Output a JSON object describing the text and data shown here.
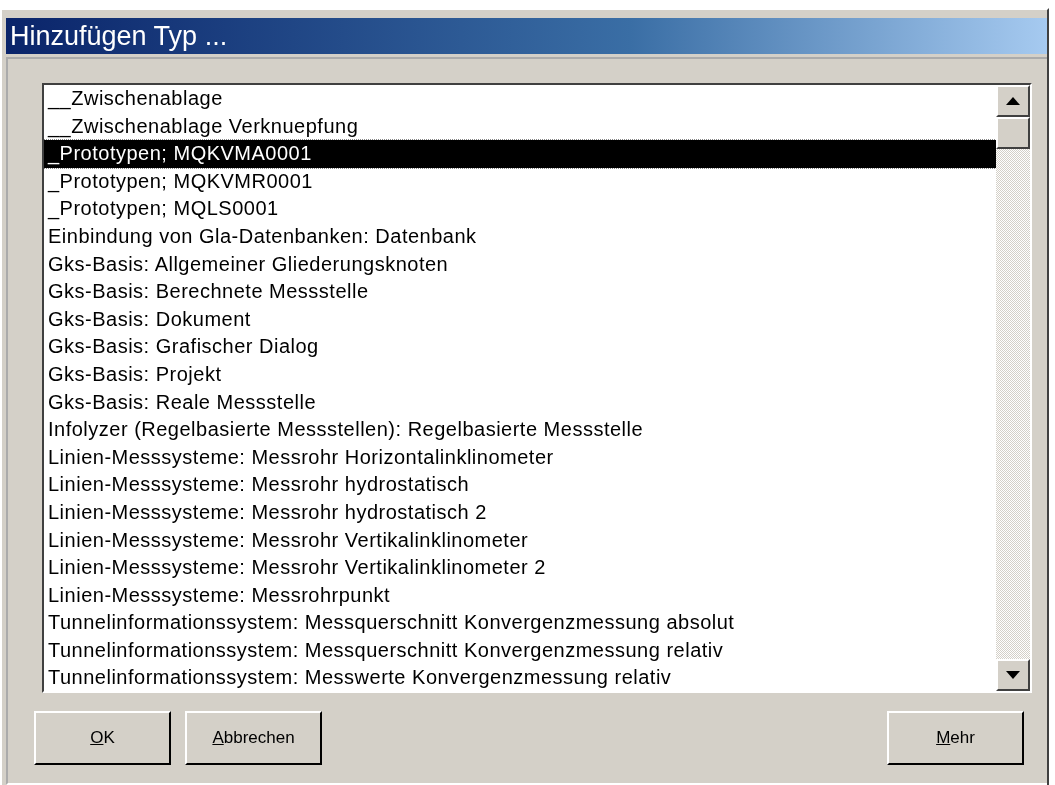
{
  "window": {
    "title": "Hinzufügen Typ ..."
  },
  "list": {
    "items": [
      {
        "label": "__Zwischenablage",
        "selected": false
      },
      {
        "label": "__Zwischenablage Verknuepfung",
        "selected": false
      },
      {
        "label": "_Prototypen; MQKVMA0001",
        "selected": true
      },
      {
        "label": "_Prototypen; MQKVMR0001",
        "selected": false
      },
      {
        "label": "_Prototypen; MQLS0001",
        "selected": false
      },
      {
        "label": "Einbindung von Gla-Datenbanken: Datenbank",
        "selected": false
      },
      {
        "label": "Gks-Basis: Allgemeiner Gliederungsknoten",
        "selected": false
      },
      {
        "label": "Gks-Basis: Berechnete Messstelle",
        "selected": false
      },
      {
        "label": "Gks-Basis: Dokument",
        "selected": false
      },
      {
        "label": "Gks-Basis: Grafischer Dialog",
        "selected": false
      },
      {
        "label": "Gks-Basis: Projekt",
        "selected": false
      },
      {
        "label": "Gks-Basis: Reale Messstelle",
        "selected": false
      },
      {
        "label": "Infolyzer (Regelbasierte Messstellen): Regelbasierte Messstelle",
        "selected": false
      },
      {
        "label": "Linien-Messsysteme: Messrohr Horizontalinklinometer",
        "selected": false
      },
      {
        "label": "Linien-Messsysteme: Messrohr hydrostatisch",
        "selected": false
      },
      {
        "label": "Linien-Messsysteme: Messrohr hydrostatisch 2",
        "selected": false
      },
      {
        "label": "Linien-Messsysteme: Messrohr Vertikalinklinometer",
        "selected": false
      },
      {
        "label": "Linien-Messsysteme: Messrohr Vertikalinklinometer 2",
        "selected": false
      },
      {
        "label": "Linien-Messsysteme: Messrohrpunkt",
        "selected": false
      },
      {
        "label": "Tunnelinformationssystem: Messquerschnitt Konvergenzmessung absolut",
        "selected": false
      },
      {
        "label": "Tunnelinformationssystem: Messquerschnitt Konvergenzmessung relativ",
        "selected": false
      },
      {
        "label": "Tunnelinformationssystem: Messwerte Konvergenzmessung relativ",
        "selected": false
      }
    ]
  },
  "buttons_left": [
    {
      "accel": "O",
      "rest": "K"
    },
    {
      "accel": "A",
      "rest": "bbrechen"
    }
  ],
  "buttons_right": [
    {
      "accel": "M",
      "rest": "ehr"
    }
  ]
}
